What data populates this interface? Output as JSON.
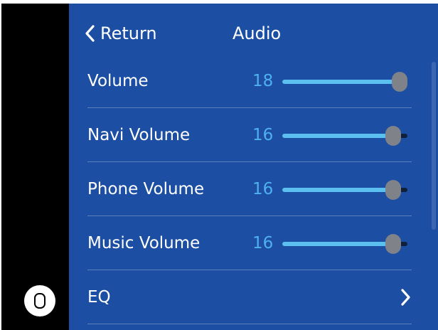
{
  "header": {
    "return_label": "Return",
    "title": "Audio"
  },
  "rows": [
    {
      "label": "Volume",
      "value": "18",
      "max": 18
    },
    {
      "label": "Navi Volume",
      "value": "16",
      "max": 18
    },
    {
      "label": "Phone Volume",
      "value": "16",
      "max": 18
    },
    {
      "label": "Music Volume",
      "value": "16",
      "max": 18
    },
    {
      "label": "EQ"
    }
  ],
  "colors": {
    "screen_background": "#1c4fa3",
    "value_text": "#4fb0ee",
    "slider_fill": "#5bc0f0",
    "slider_thumb": "#7f8288"
  },
  "icons": {
    "back": "chevron-left-icon",
    "eq_arrow": "chevron-right-icon",
    "home": "home-button-icon"
  }
}
